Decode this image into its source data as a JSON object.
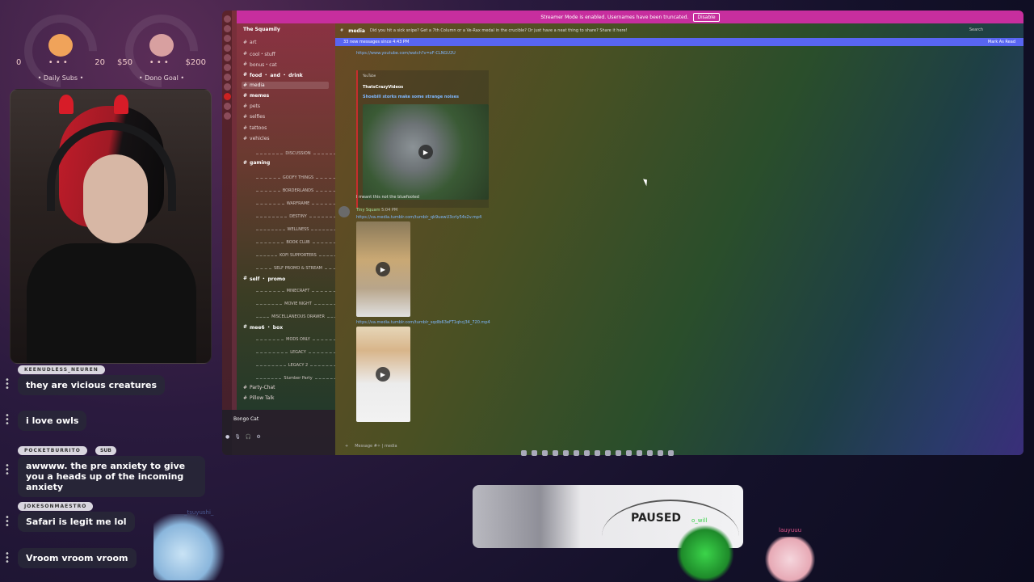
{
  "overlay": {
    "daily_subs": {
      "min": "0",
      "max": "20",
      "label": "• Daily Subs •",
      "dots": "• • •"
    },
    "dono_goal": {
      "min": "$50",
      "max": "$200",
      "label": "• Dono Goal •",
      "dots": "• • •"
    }
  },
  "chat": [
    {
      "user": "KEENUDLESS_NEUREN",
      "text": "they are vicious creatures"
    },
    {
      "user": "",
      "text": "i love owls"
    },
    {
      "user": "POCKETBURRITO",
      "badge": "SUB",
      "text": "awwww. the pre anxiety to give you a heads up of the incoming anxiety"
    },
    {
      "user": "JOKESONMAESTRO",
      "text": "Safari is legit me lol"
    },
    {
      "user": "",
      "text": "Vroom vroom vroom"
    }
  ],
  "discord": {
    "streamer_bar": {
      "text": "Streamer Mode is enabled. Usernames have been truncated.",
      "button": "Disable"
    },
    "guild_name": "The Squamily",
    "channels": [
      {
        "label": "art"
      },
      {
        "label": "cool・stuff"
      },
      {
        "label": "bonus・cat"
      },
      {
        "label": "food ・ and ・ drink"
      },
      {
        "label": "media"
      },
      {
        "label": "memes"
      },
      {
        "label": "pets"
      },
      {
        "label": "selfies"
      },
      {
        "label": "tattoos"
      },
      {
        "label": "vehicles"
      }
    ],
    "categories": {
      "discussion": "DISCUSSION",
      "gaming": "gaming",
      "goofy_things": "GOOFY THINGS",
      "borderlands": "BORDERLANDS",
      "warframe": "WARFRAME",
      "destiny": "DESTINY",
      "wellness": "WELLNESS",
      "book_club": "BOOK CLUB",
      "kofi": "KOFI SUPPORTERS",
      "self_promo_cat": "SELF PROMO & STREAM",
      "self_promo": "self ・ promo",
      "minecraft": "MINECRAFT",
      "movie_night": "MOVIE NIGHT",
      "misc": "MISCELLANEOUS DRAWER",
      "mee6": "mee6 ・ box",
      "mods_only": "MODS ONLY",
      "legacy": "LEGACY",
      "legacy2": "LEGACY 2",
      "slumber": "Slumber Party",
      "party_chat": "Party-Chat",
      "pillow_talk": "Pillow Talk"
    },
    "user": {
      "name": "Bongo Cat"
    },
    "topbar": {
      "channel": "media",
      "topic": "Did you hit a sick snipe? Get a 7th Column or a Ve-Rax medal in the crucible? Or just have a neat thing to share? Share it here!",
      "search": "Search"
    },
    "new_messages": {
      "text": "33 new messages since 4:43 PM",
      "action": "Mark As Read"
    },
    "messages": {
      "yt_link": "https://www.youtube.com/watch?v=oF-CLNGU2U",
      "embed_provider": "YouTube",
      "embed_author": "ThatsCrazyVideos",
      "embed_title": "Shoebill storks make some strange noises",
      "note": "I meant this not the bluefooted",
      "author": "Tiny",
      "author_tag": "Squam",
      "time": "5:04 PM",
      "link2": "https://va.media.tumblr.com/tumblr_qk9uewU3crIy54s2v.mp4",
      "link3": "https://va.media.tumblr.com/tumblr_sqdIb63eFT1qhcj34_720.mp4"
    },
    "composer_placeholder": "Message #✧ | media"
  },
  "paused_label": "PAUSED",
  "sprites": {
    "left_name": "_tsuyushi_",
    "mid_name": "o_will",
    "right_name": "lauyuuu"
  }
}
